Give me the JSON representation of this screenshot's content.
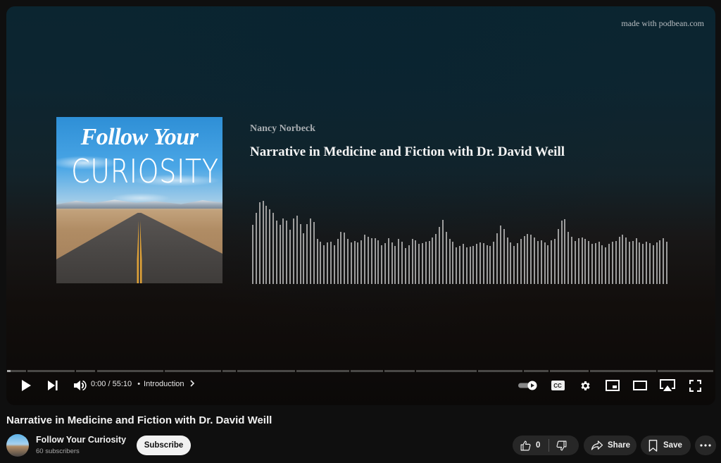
{
  "player": {
    "credit": "made with podbean.com",
    "cover_art": {
      "title_line1": "Follow Your",
      "title_line2": "CURIOSITY"
    },
    "episode_author": "Nancy Norbeck",
    "episode_title": "Narrative in Medicine and Fiction with Dr. David Weill",
    "waveform_levels": [
      0.71,
      0.86,
      0.98,
      1.0,
      0.94,
      0.9,
      0.86,
      0.76,
      0.71,
      0.79,
      0.76,
      0.65,
      0.79,
      0.82,
      0.72,
      0.61,
      0.72,
      0.79,
      0.75,
      0.54,
      0.51,
      0.47,
      0.5,
      0.51,
      0.47,
      0.54,
      0.63,
      0.62,
      0.54,
      0.5,
      0.52,
      0.5,
      0.53,
      0.59,
      0.57,
      0.55,
      0.55,
      0.53,
      0.47,
      0.49,
      0.55,
      0.5,
      0.46,
      0.54,
      0.51,
      0.43,
      0.47,
      0.54,
      0.53,
      0.48,
      0.49,
      0.51,
      0.52,
      0.56,
      0.6,
      0.69,
      0.77,
      0.63,
      0.54,
      0.51,
      0.44,
      0.46,
      0.48,
      0.44,
      0.45,
      0.46,
      0.48,
      0.5,
      0.49,
      0.47,
      0.46,
      0.51,
      0.61,
      0.7,
      0.66,
      0.56,
      0.5,
      0.46,
      0.49,
      0.54,
      0.58,
      0.6,
      0.59,
      0.56,
      0.52,
      0.53,
      0.5,
      0.47,
      0.53,
      0.54,
      0.66,
      0.76,
      0.78,
      0.63,
      0.57,
      0.52,
      0.55,
      0.56,
      0.54,
      0.52,
      0.48,
      0.49,
      0.51,
      0.47,
      0.44,
      0.48,
      0.51,
      0.52,
      0.57,
      0.59,
      0.56,
      0.51,
      0.52,
      0.55,
      0.5,
      0.48,
      0.51,
      0.49,
      0.47,
      0.5,
      0.53,
      0.55,
      0.51
    ],
    "progress": {
      "current": "0:00",
      "duration": "55:10",
      "separator": " / ",
      "played_fraction": 0.0,
      "chapter_boundaries": [
        0.0,
        0.028,
        0.097,
        0.126,
        0.222,
        0.304,
        0.325,
        0.408,
        0.485,
        0.533,
        0.578,
        0.665,
        0.73,
        0.767,
        0.824,
        0.919,
        1.0
      ]
    },
    "chapter_label": "Introduction",
    "controls": {
      "play": "play-icon",
      "next": "next-icon",
      "volume": "volume-icon",
      "autoplay": "autoplay-toggle",
      "captions": "CC",
      "settings": "gear-icon",
      "miniplayer": "miniplayer-icon",
      "theater": "theater-icon",
      "airplay": "airplay-icon",
      "fullscreen": "fullscreen-icon"
    }
  },
  "video": {
    "title": "Narrative in Medicine and Fiction with Dr. David Weill",
    "channel_name": "Follow Your Curiosity",
    "subscribers": "60 subscribers",
    "subscribe_label": "Subscribe",
    "like_count": "0",
    "share_label": "Share",
    "save_label": "Save"
  }
}
